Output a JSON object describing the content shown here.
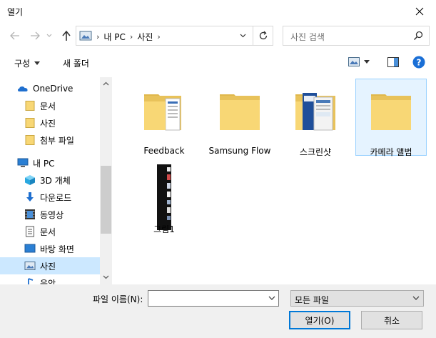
{
  "window": {
    "title": "열기"
  },
  "navigation": {
    "crumbs": [
      "내 PC",
      "사진"
    ],
    "search_placeholder": "사진 검색"
  },
  "toolbar": {
    "organize_label": "구성",
    "new_folder_label": "새 폴더"
  },
  "sidebar": {
    "items": [
      {
        "label": "OneDrive"
      },
      {
        "label": "문서"
      },
      {
        "label": "사진"
      },
      {
        "label": "첨부 파일"
      },
      {
        "label": "내 PC"
      },
      {
        "label": "3D 개체"
      },
      {
        "label": "다운로드"
      },
      {
        "label": "동영상"
      },
      {
        "label": "문서"
      },
      {
        "label": "바탕 화면"
      },
      {
        "label": "사진"
      },
      {
        "label": "음악"
      }
    ]
  },
  "files": [
    {
      "name": "Feedback"
    },
    {
      "name": "Samsung Flow"
    },
    {
      "name": "스크린샷"
    },
    {
      "name": "카메라 앨범"
    },
    {
      "name": "그림1"
    }
  ],
  "bottom": {
    "filename_label": "파일 이름(N):",
    "filename_value": "",
    "filetype_value": "모든 파일",
    "open_label": "열기(O)",
    "cancel_label": "취소"
  },
  "colors": {
    "accent": "#0078d7",
    "selection": "#cce8ff",
    "folder": "#f8d775"
  }
}
